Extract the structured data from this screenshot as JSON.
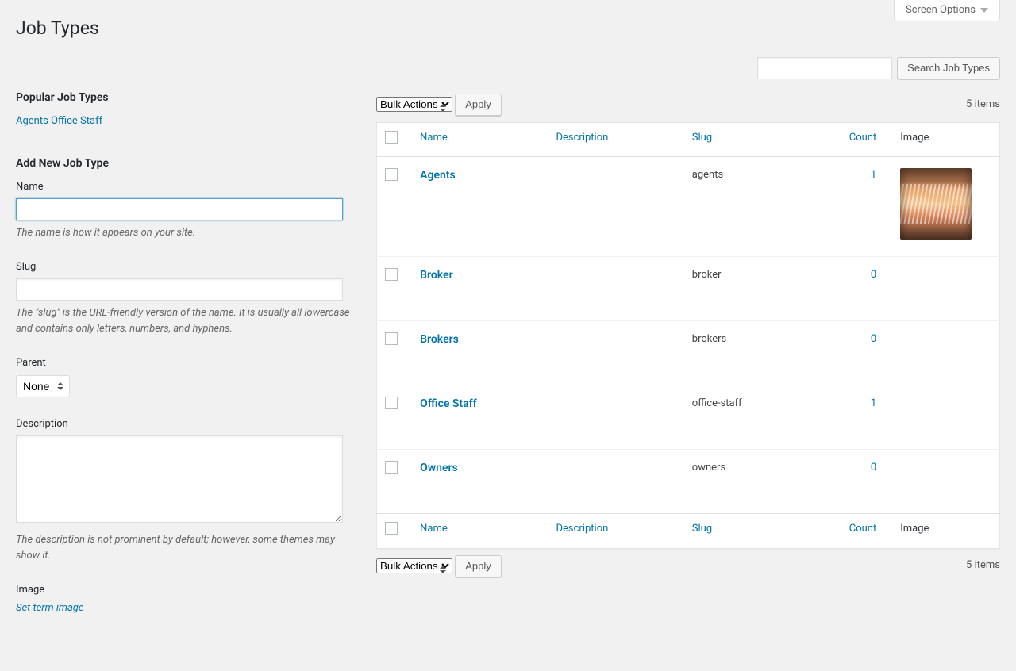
{
  "screenOptions": "Screen Options",
  "pageTitle": "Job Types",
  "searchButton": "Search Job Types",
  "popular": {
    "heading": "Popular Job Types",
    "tags": [
      "Agents",
      "Office Staff"
    ]
  },
  "form": {
    "heading": "Add New Job Type",
    "name": {
      "label": "Name",
      "value": "",
      "hint": "The name is how it appears on your site."
    },
    "slug": {
      "label": "Slug",
      "value": "",
      "hint": "The \"slug\" is the URL-friendly version of the name. It is usually all lowercase and contains only letters, numbers, and hyphens."
    },
    "parent": {
      "label": "Parent",
      "selected": "None"
    },
    "description": {
      "label": "Description",
      "value": "",
      "hint": "The description is not prominent by default; however, some themes may show it."
    },
    "image": {
      "label": "Image",
      "link": "Set term image"
    }
  },
  "bulk": {
    "selected": "Bulk Actions",
    "apply": "Apply"
  },
  "countText": "5 items",
  "columns": {
    "name": "Name",
    "description": "Description",
    "slug": "Slug",
    "count": "Count",
    "image": "Image"
  },
  "rows": [
    {
      "name": "Agents",
      "description": "",
      "slug": "agents",
      "count": "1",
      "hasImage": true
    },
    {
      "name": "Broker",
      "description": "",
      "slug": "broker",
      "count": "0",
      "hasImage": false
    },
    {
      "name": "Brokers",
      "description": "",
      "slug": "brokers",
      "count": "0",
      "hasImage": false
    },
    {
      "name": "Office Staff",
      "description": "",
      "slug": "office-staff",
      "count": "1",
      "hasImage": false
    },
    {
      "name": "Owners",
      "description": "",
      "slug": "owners",
      "count": "0",
      "hasImage": false
    }
  ]
}
